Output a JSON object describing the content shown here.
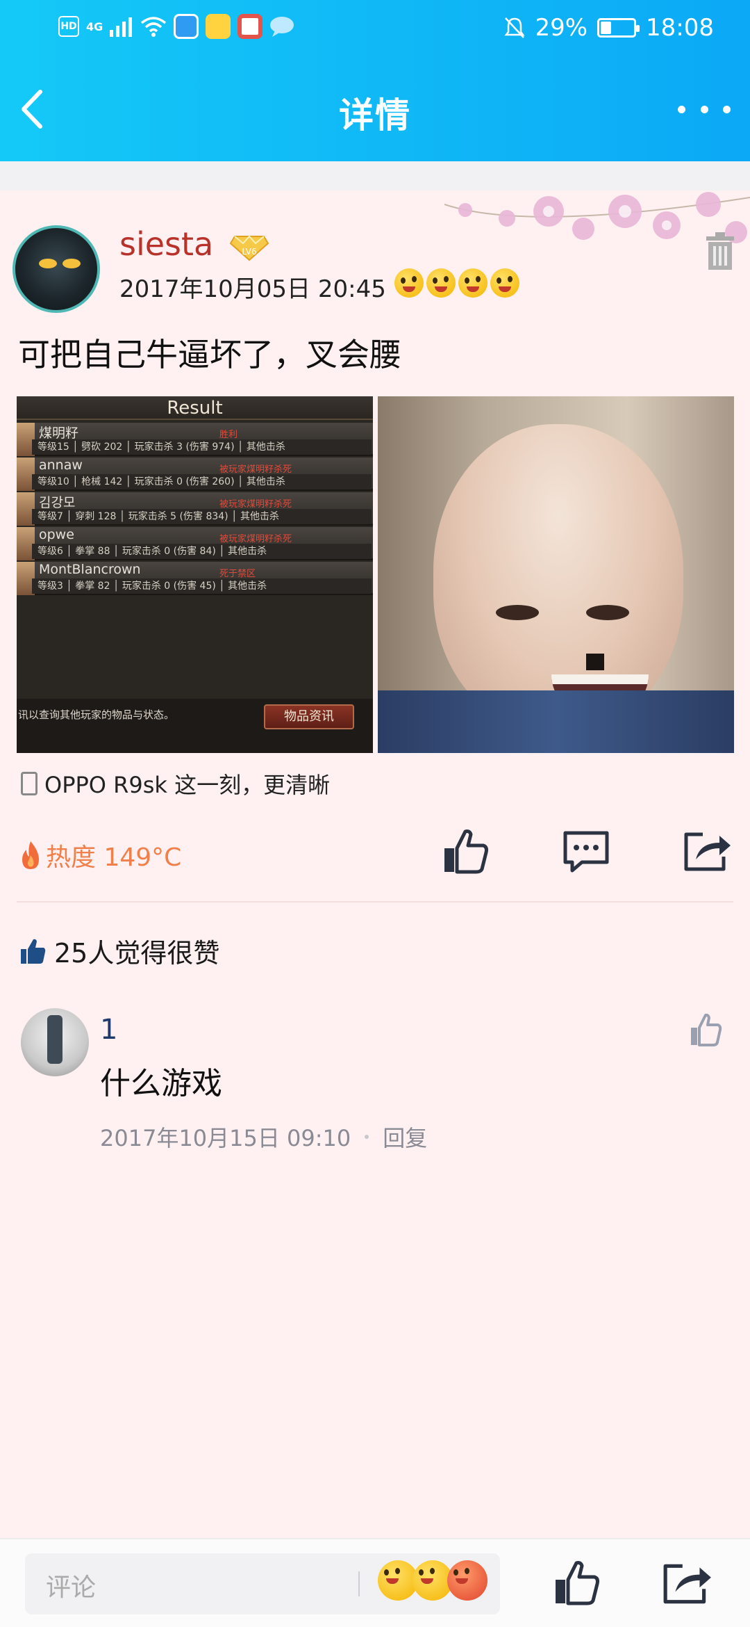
{
  "status": {
    "network": "4G",
    "hd": "HD",
    "battery": "29%",
    "battery_level": 0.29,
    "time": "18:08"
  },
  "header": {
    "title": "详情"
  },
  "post": {
    "username": "siesta",
    "level_badge": "LV6",
    "date": "2017年10月05日 20:45",
    "text": "可把自己牛逼坏了，叉会腰",
    "device": "OPPO R9sk 这一刻，更清晰",
    "heat": "热度 149°C"
  },
  "game_result": {
    "title": "Result",
    "rows": [
      {
        "name": "煤明籽",
        "status": "胜利",
        "stats": "等级15 │ 劈砍 202 │ 玩家击杀 3 (伤害 974) │ 其他击杀"
      },
      {
        "name": "annaw",
        "status": "被玩家煤明籽杀死",
        "stats": "等级10 │ 枪械 142 │ 玩家击杀 0 (伤害 260) │ 其他击杀"
      },
      {
        "name": "김강모",
        "status": "被玩家煤明籽杀死",
        "stats": "等级7 │ 穿刺 128 │ 玩家击杀 5 (伤害 834) │ 其他击杀"
      },
      {
        "name": "opwe",
        "status": "被玩家煤明籽杀死",
        "stats": "等级6 │ 拳掌 88 │ 玩家击杀 0 (伤害 84) │ 其他击杀"
      },
      {
        "name": "MontBlancrown",
        "status": "死于禁区",
        "stats": "等级3 │ 拳掌 82 │ 玩家击杀 0 (伤害 45) │ 其他击杀"
      }
    ],
    "footer_text": "讯以查询其他玩家的物品与状态。",
    "footer_button": "物品资讯"
  },
  "likes": {
    "text": "25人觉得很赞"
  },
  "comment": {
    "name": "1",
    "text": "什么游戏",
    "date": "2017年10月15日 09:10",
    "reply": "回复"
  },
  "bottom": {
    "placeholder": "评论"
  },
  "colors": {
    "header_start": "#14c9f7",
    "header_end": "#0ca9f6",
    "username": "#b9322a",
    "heat": "#f07f4a",
    "comment_name": "#1d3a6a",
    "background": "#fff1f1"
  }
}
